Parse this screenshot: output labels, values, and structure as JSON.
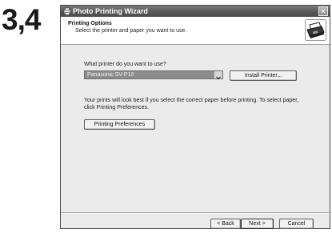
{
  "step_label": "3,4",
  "window": {
    "title": "Photo Printing Wizard",
    "close_glyph": "×"
  },
  "header": {
    "title": "Printing Options",
    "subtitle": "Select the printer and paper you want to use."
  },
  "printer": {
    "question": "What printer do you want to use?",
    "selected": "Panasonic SV-P10",
    "install_label": "Install Printer..."
  },
  "info_text": "Your prints will look best if you select the correct paper before printing. To select paper, click Printing Preferences.",
  "preferences_label": "Printing Preferences",
  "footer": {
    "back_label": "< Back",
    "next_label": "Next >",
    "cancel_label": "Cancel"
  },
  "icons": {
    "app": "photo-wizard-icon",
    "close": "close-icon",
    "header_graphic": "printer-icon",
    "dropdown": "chevron-down-icon"
  }
}
